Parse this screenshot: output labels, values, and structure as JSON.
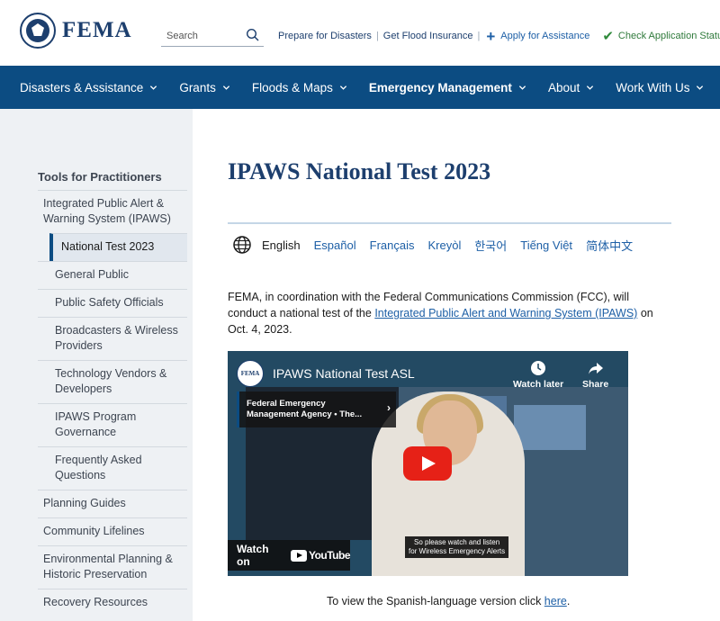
{
  "header": {
    "logo_text": "FEMA",
    "search_placeholder": "Search",
    "links": {
      "prepare": "Prepare for Disasters",
      "flood": "Get Flood Insurance",
      "apply": "Apply for Assistance",
      "check": "Check Application Status"
    }
  },
  "nav": {
    "items": [
      {
        "label": "Disasters & Assistance"
      },
      {
        "label": "Grants"
      },
      {
        "label": "Floods & Maps"
      },
      {
        "label": "Emergency Management"
      },
      {
        "label": "About"
      },
      {
        "label": "Work With Us"
      }
    ]
  },
  "sidebar": {
    "heading": "Tools for Practitioners",
    "items": [
      {
        "label": "Integrated Public Alert & Warning System (IPAWS)"
      },
      {
        "label": "National Test 2023"
      },
      {
        "label": "General Public"
      },
      {
        "label": "Public Safety Officials"
      },
      {
        "label": "Broadcasters & Wireless Providers"
      },
      {
        "label": "Technology Vendors & Developers"
      },
      {
        "label": "IPAWS Program Governance"
      },
      {
        "label": "Frequently Asked Questions"
      },
      {
        "label": "Planning Guides"
      },
      {
        "label": "Community Lifelines"
      },
      {
        "label": "Environmental Planning & Historic Preservation"
      },
      {
        "label": "Recovery Resources"
      }
    ]
  },
  "main": {
    "title": "IPAWS National Test 2023",
    "languages": [
      "English",
      "Español",
      "Français",
      "Kreyòl",
      "한국어",
      "Tiếng Việt",
      "简体中文"
    ],
    "intro": {
      "before": "FEMA, in coordination with the Federal Communications Commission (FCC), will conduct a national test of the ",
      "link": "Integrated Public Alert and Warning System (IPAWS)",
      "after": " on Oct. 4, 2023."
    },
    "video": {
      "logo": "FEMA",
      "title": "IPAWS National Test ASL",
      "watch_later": "Watch later",
      "share": "Share",
      "card_text": "Federal Emergency Management Agency • The...",
      "caption_line1": "So please watch and listen",
      "caption_line2": "for Wireless Emergency Alerts",
      "watch_on": "Watch on",
      "youtube": "YouTube"
    },
    "spanish": {
      "before": "To view the Spanish-language version click ",
      "link": "here",
      "after": "."
    }
  },
  "colors": {
    "nav_bg": "#0c4c82",
    "brand_blue": "#1d3f6e",
    "link_blue": "#1d5fa6",
    "sidebar_bg": "#eef1f4",
    "check_green": "#2f8a3b",
    "youtube_red": "#e62117"
  }
}
